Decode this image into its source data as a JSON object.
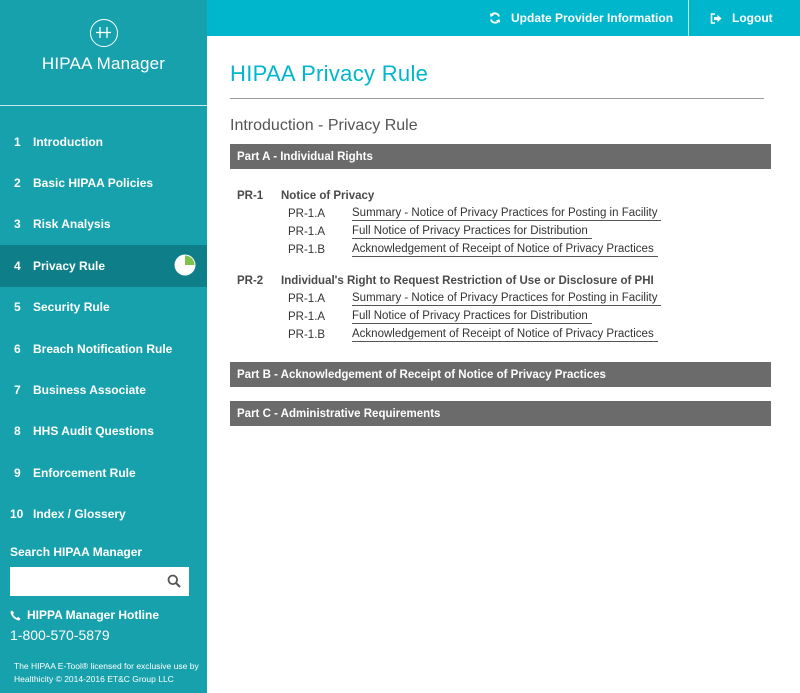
{
  "sidebar": {
    "brand": "HIPAA Manager",
    "items": [
      {
        "num": "1",
        "label": "Introduction"
      },
      {
        "num": "2",
        "label": "Basic HIPAA Policies"
      },
      {
        "num": "3",
        "label": "Risk Analysis"
      },
      {
        "num": "4",
        "label": "Privacy Rule",
        "active": true,
        "progress": 0.75
      },
      {
        "num": "5",
        "label": "Security Rule"
      },
      {
        "num": "6",
        "label": "Breach Notification Rule"
      },
      {
        "num": "7",
        "label": "Business Associate"
      },
      {
        "num": "8",
        "label": "HHS Audit Questions"
      },
      {
        "num": "9",
        "label": "Enforcement Rule"
      },
      {
        "num": "10",
        "label": "Index / Glossery"
      }
    ],
    "search_title": "Search HIPAA Manager",
    "search_value": "",
    "hotline_title": "HIPPA Manager Hotline",
    "hotline_phone": "1-800-570-5879",
    "footer": "The HIPAA E-Tool® licensed for exclusive use by Healthicity © 2014-2016 ET&C Group LLC"
  },
  "topbar": {
    "update_label": "Update Provider Information",
    "logout_label": "Logout"
  },
  "main": {
    "title": "HIPAA Privacy Rule",
    "section": "Introduction - Privacy Rule",
    "part_a": "Part A - Individual Rights",
    "groups": [
      {
        "code": "PR-1",
        "title": "Notice of Privacy",
        "rows": [
          {
            "sub": "PR-1.A",
            "link": "Summary - Notice of Privacy Practices for Posting in Facility"
          },
          {
            "sub": "PR-1.A",
            "link": "Full Notice of Privacy Practices for Distribution"
          },
          {
            "sub": "PR-1.B",
            "link": "Acknowledgement of Receipt of Notice of Privacy Practices"
          }
        ]
      },
      {
        "code": "PR-2",
        "title": "Individual's Right to Request Restriction of Use or Disclosure of PHI",
        "rows": [
          {
            "sub": "PR-1.A",
            "link": "Summary - Notice of Privacy Practices for Posting in Facility"
          },
          {
            "sub": "PR-1.A",
            "link": "Full Notice of Privacy Practices for Distribution"
          },
          {
            "sub": "PR-1.B",
            "link": "Acknowledgement of Receipt of Notice of Privacy Practices"
          }
        ]
      }
    ],
    "part_b": "Part B - Acknowledgement of Receipt of Notice of Privacy Practices",
    "part_c": "Part C - Administrative Requirements"
  },
  "colors": {
    "sidebar": "#17a1ac",
    "sidebar_active": "#0e7f88",
    "topbar": "#00b6cd",
    "title": "#00b6cd",
    "part_bar": "#6b6b6b"
  },
  "icons": {
    "logo": "hipaa-h-logo-icon",
    "update": "refresh-icon",
    "logout": "sign-out-icon",
    "search": "search-icon",
    "phone": "phone-icon",
    "progress": "progress-pie-icon"
  }
}
